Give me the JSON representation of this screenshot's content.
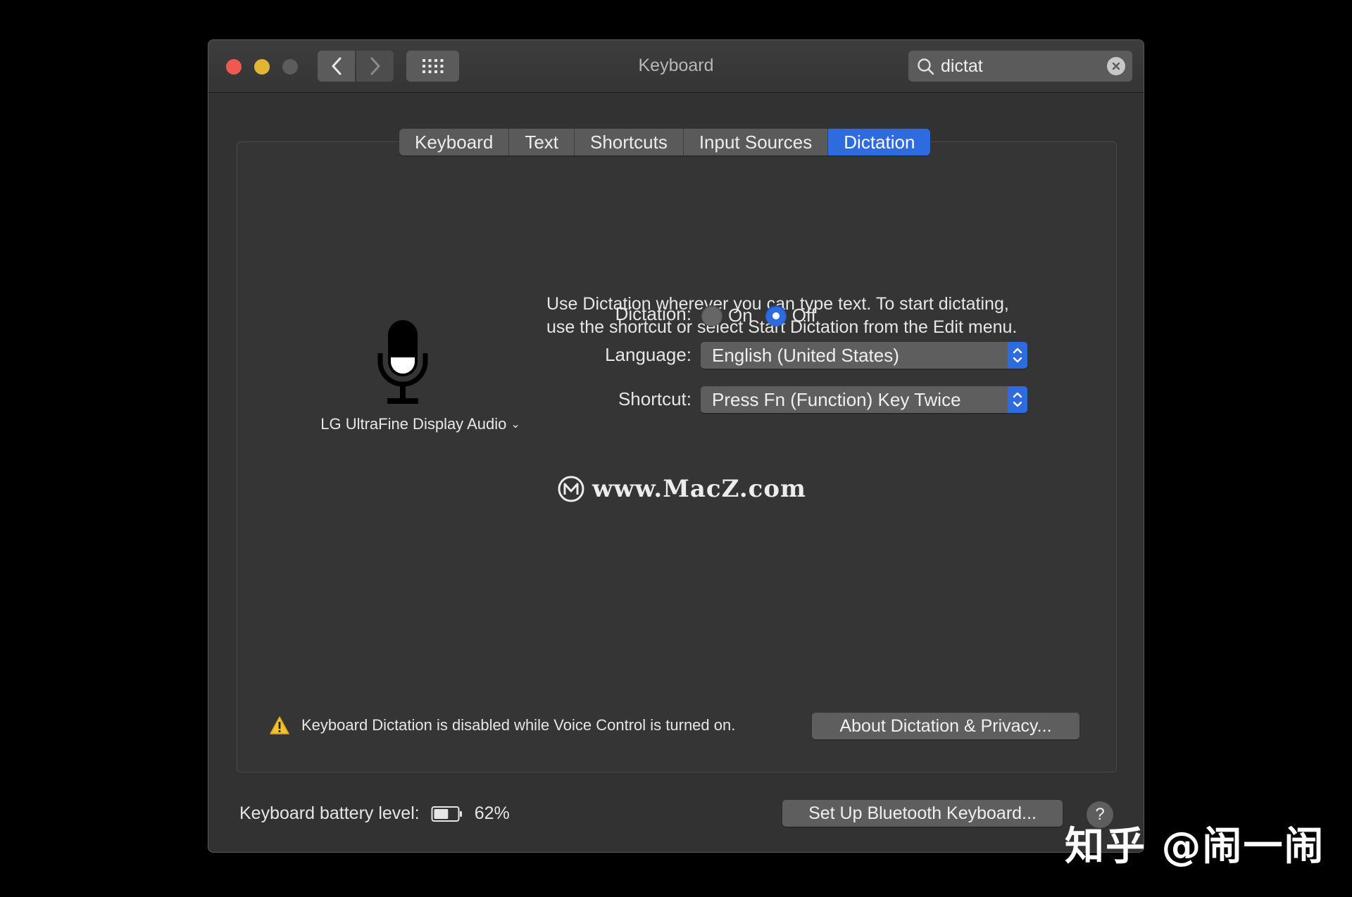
{
  "window": {
    "title": "Keyboard"
  },
  "search": {
    "value": "dictat"
  },
  "tabs": [
    {
      "label": "Keyboard"
    },
    {
      "label": "Text"
    },
    {
      "label": "Shortcuts"
    },
    {
      "label": "Input Sources"
    },
    {
      "label": "Dictation",
      "active": true
    }
  ],
  "dictation": {
    "microphone_device": "LG UltraFine Display Audio",
    "description_line1": "Use Dictation wherever you can type text. To start dictating,",
    "description_line2": "use the shortcut or select Start Dictation from the Edit menu.",
    "dictation_label": "Dictation:",
    "on_label": "On",
    "off_label": "Off",
    "selected": "Off",
    "language_label": "Language:",
    "language_value": "English (United States)",
    "shortcut_label": "Shortcut:",
    "shortcut_value": "Press Fn (Function) Key Twice",
    "warning_text": "Keyboard Dictation is disabled while Voice Control is turned on.",
    "about_button": "About Dictation & Privacy..."
  },
  "watermark": "www.MacZ.com",
  "footer": {
    "battery_label": "Keyboard battery level:",
    "battery_value": "62%",
    "battery_level": 0.62,
    "bluetooth_button": "Set Up Bluetooth Keyboard...",
    "help": "?"
  },
  "overlay_watermark": "知乎 @闹一闹",
  "colors": {
    "accent": "#2e6bdf",
    "window_bg": "#323232",
    "close": "#ee5a52",
    "minimize": "#e3b535"
  }
}
